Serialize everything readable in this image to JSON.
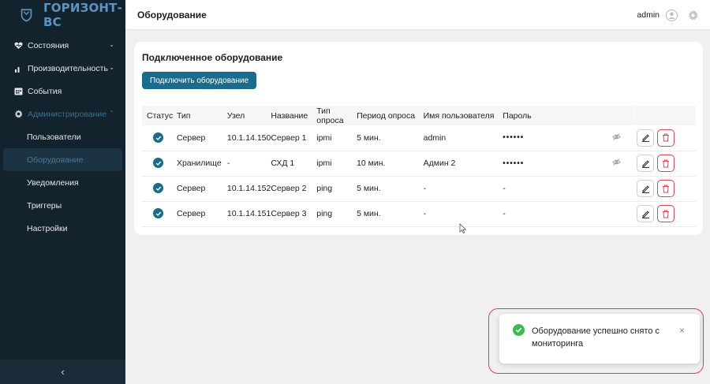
{
  "app": {
    "logo_text": "ГОРИЗОНТ-ВС"
  },
  "sidebar": {
    "items": [
      {
        "label": "Состояния",
        "icon": "heart-pulse-icon",
        "expanded": false
      },
      {
        "label": "Производительность",
        "icon": "bar-chart-icon",
        "expanded": false
      },
      {
        "label": "События",
        "icon": "calendar-icon"
      },
      {
        "label": "Администрирование",
        "icon": "gear-icon",
        "expanded": true,
        "children": [
          "Пользователи",
          "Оборудование",
          "Уведомления",
          "Триггеры",
          "Настройки"
        ]
      }
    ],
    "selected": "Оборудование",
    "collapse_glyph": "‹"
  },
  "header": {
    "title": "Оборудование",
    "user": "admin"
  },
  "card": {
    "title": "Подключенное оборудование",
    "connect_button": "Подключить оборудование"
  },
  "table": {
    "columns": [
      "Статус",
      "Тип",
      "Узел",
      "Название",
      "Тип опроса",
      "Период опроса",
      "Имя пользователя",
      "Пароль"
    ],
    "rows": [
      {
        "type": "Сервер",
        "node": "10.1.14.150",
        "name": "Сервер 1",
        "poll": "ipmi",
        "period": "5 мин.",
        "user": "admin",
        "password": "••••••",
        "has_eye": true
      },
      {
        "type": "Хранилище",
        "node": "-",
        "name": "СХД 1",
        "poll": "ipmi",
        "period": "10 мин.",
        "user": "Админ 2",
        "password": "••••••",
        "has_eye": true
      },
      {
        "type": "Сервер",
        "node": "10.1.14.152",
        "name": "Сервер 2",
        "poll": "ping",
        "period": "5 мин.",
        "user": "-",
        "password": "-",
        "has_eye": false
      },
      {
        "type": "Сервер",
        "node": "10.1.14.151",
        "name": "Сервер 3",
        "poll": "ping",
        "period": "5 мин.",
        "user": "-",
        "password": "-",
        "has_eye": false
      }
    ]
  },
  "toast": {
    "message": "Оборудование успешно снято с мониторинга",
    "close_glyph": "×"
  },
  "colors": {
    "sidebar_bg": "#12232e",
    "accent": "#1b6c8c",
    "danger": "#e5434e",
    "success": "#3dbb4f",
    "highlight": "#e03f3f"
  }
}
